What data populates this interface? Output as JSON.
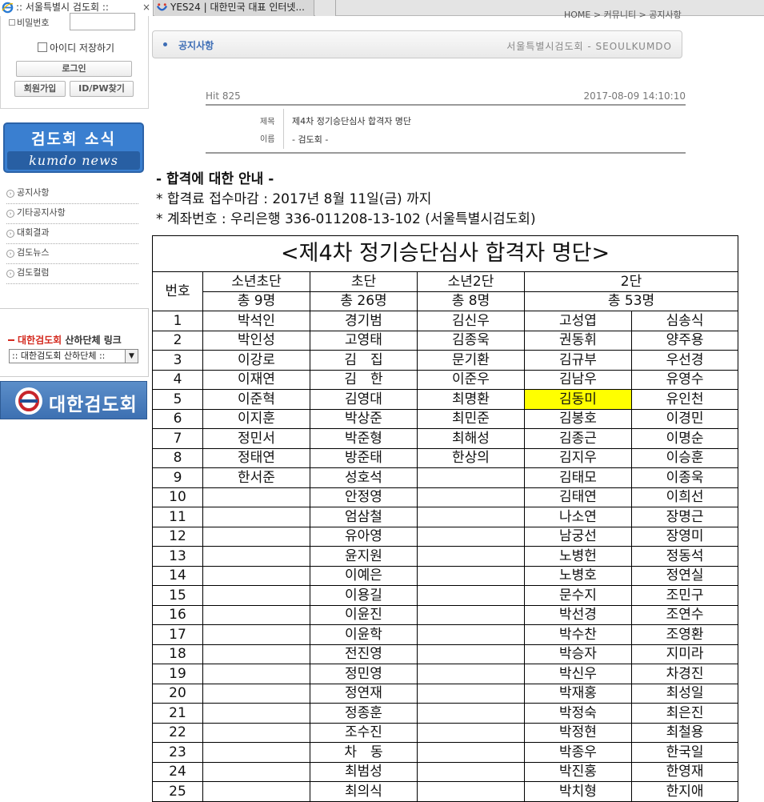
{
  "tabs": [
    {
      "title": ":: 서울특별시 검도회 ::",
      "close": "×"
    },
    {
      "title": "YES24 | 대한민국 대표 인터넷..."
    }
  ],
  "login": {
    "password_label": "비밀번호",
    "remember_label": "아이디 저장하기",
    "login_button": "로그인",
    "join_button": "회원가입",
    "find_button": "ID/PW찾기"
  },
  "banner": {
    "top": "검도회 소식",
    "bottom": "kumdo news"
  },
  "menu": [
    "공지사항",
    "기타공지사항",
    "대회결과",
    "검도뉴스",
    "검도컬럼"
  ],
  "links": {
    "title_red": "대한검도회",
    "title_rest": " 산하단체 링크",
    "select_value": ":: 대한검도회 산하단체 ::"
  },
  "kaf_logo": "대한검도회",
  "breadcrumb": "HOME > 커뮤니티 > 공지사항",
  "notice_bar": {
    "title": "공지사항",
    "org": "서울특별시검도회 - SEOULKUMDO"
  },
  "post": {
    "hit": "Hit 825",
    "date": "2017-08-09 14:10:10",
    "subject_label": "제목",
    "subject": "제4차 정기승단심사 합격자 명단",
    "name_label": "이름",
    "name": "- 검도회 -"
  },
  "body_lines": [
    "- 합격에 대한 안내 -",
    "* 합격료 접수마감 : 2017년 8월 11일(금) 까지",
    "* 계좌번호 : 우리은행 336-011208-13-102 (서울특별시검도회)"
  ],
  "table": {
    "title": "<제4차 정기승단심사 합격자 명단>",
    "num_header": "번호",
    "columns": [
      {
        "name": "소년초단",
        "total": "총 9명"
      },
      {
        "name": "초단",
        "total": "총 26명"
      },
      {
        "name": "소년2단",
        "total": "총 8명"
      },
      {
        "name": "2단",
        "total": "총 53명"
      }
    ],
    "rows": [
      [
        "1",
        "박석인",
        "경기범",
        "김신우",
        "고성엽",
        "심송식"
      ],
      [
        "2",
        "박인성",
        "고영태",
        "김종욱",
        "권동휘",
        "양주용"
      ],
      [
        "3",
        "이강로",
        "김　집",
        "문기환",
        "김규부",
        "우선경"
      ],
      [
        "4",
        "이재연",
        "김　한",
        "이준우",
        "김남우",
        "유영수"
      ],
      [
        "5",
        "이준혁",
        "김영대",
        "최명환",
        "김동미",
        "유인천"
      ],
      [
        "6",
        "이지훈",
        "박상준",
        "최민준",
        "김봉호",
        "이경민"
      ],
      [
        "7",
        "정민서",
        "박준형",
        "최해성",
        "김종근",
        "이명순"
      ],
      [
        "8",
        "정태연",
        "방준태",
        "한상의",
        "김지우",
        "이승훈"
      ],
      [
        "9",
        "한서준",
        "성호석",
        "",
        "김태모",
        "이종욱"
      ],
      [
        "10",
        "",
        "안정영",
        "",
        "김태연",
        "이희선"
      ],
      [
        "11",
        "",
        "엄삼철",
        "",
        "나소연",
        "장명근"
      ],
      [
        "12",
        "",
        "유아영",
        "",
        "남궁선",
        "장영미"
      ],
      [
        "13",
        "",
        "윤지원",
        "",
        "노병헌",
        "정동석"
      ],
      [
        "14",
        "",
        "이예은",
        "",
        "노병호",
        "정연실"
      ],
      [
        "15",
        "",
        "이용길",
        "",
        "문수지",
        "조민구"
      ],
      [
        "16",
        "",
        "이윤진",
        "",
        "박선경",
        "조연수"
      ],
      [
        "17",
        "",
        "이윤학",
        "",
        "박수찬",
        "조영환"
      ],
      [
        "18",
        "",
        "전진영",
        "",
        "박승자",
        "지미라"
      ],
      [
        "19",
        "",
        "정민영",
        "",
        "박신우",
        "차경진"
      ],
      [
        "20",
        "",
        "정연재",
        "",
        "박재홍",
        "최성일"
      ],
      [
        "21",
        "",
        "정종훈",
        "",
        "박정숙",
        "최은진"
      ],
      [
        "22",
        "",
        "조수진",
        "",
        "박정현",
        "최철용"
      ],
      [
        "23",
        "",
        "차　동",
        "",
        "박종우",
        "한국일"
      ],
      [
        "24",
        "",
        "최범성",
        "",
        "박진홍",
        "한영재"
      ],
      [
        "25",
        "",
        "최의식",
        "",
        "박치형",
        "한지애"
      ]
    ],
    "highlight": {
      "row": 4,
      "col": 4,
      "color": "#ffff00"
    }
  }
}
